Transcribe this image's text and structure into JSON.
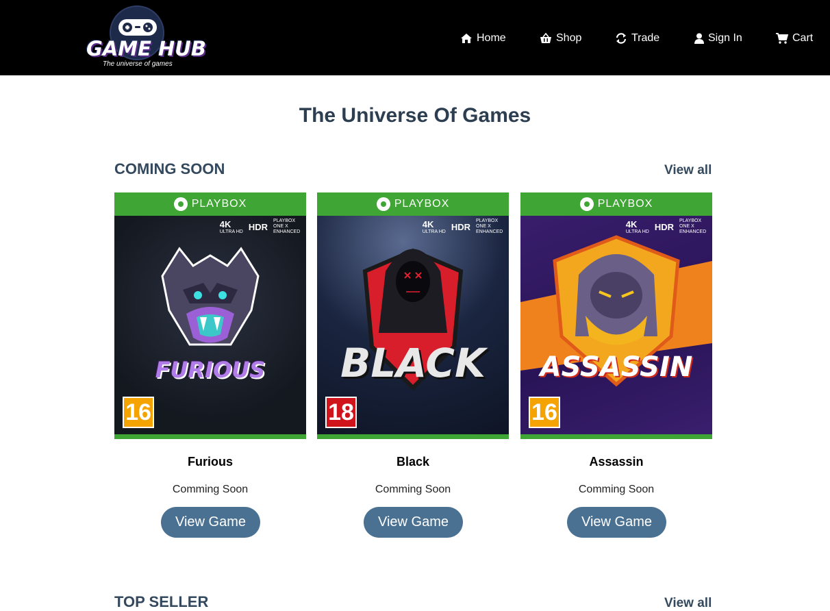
{
  "brand": {
    "name": "GAME HUB",
    "tagline": "The universe of games"
  },
  "nav": [
    {
      "label": "Home",
      "icon": "home-icon"
    },
    {
      "label": "Shop",
      "icon": "basket-icon"
    },
    {
      "label": "Trade",
      "icon": "refresh-icon"
    },
    {
      "label": "Sign In",
      "icon": "user-icon"
    },
    {
      "label": "Cart",
      "icon": "cart-icon"
    }
  ],
  "page_title": "The Universe Of Games",
  "sections": [
    {
      "title": "COMING SOON",
      "view_all": "View all",
      "games": [
        {
          "cover_brand": "PLAYBOX",
          "cover_art_text": "FURIOUS",
          "age_rating": "16",
          "age_color": "#f4a300",
          "name": "Furious",
          "status": "Comming Soon",
          "button": "View Game"
        },
        {
          "cover_brand": "PLAYBOX",
          "cover_art_text": "BLACK",
          "age_rating": "18",
          "age_color": "#d0141c",
          "name": "Black",
          "status": "Comming Soon",
          "button": "View Game"
        },
        {
          "cover_brand": "PLAYBOX",
          "cover_art_text": "ASSASSIN",
          "age_rating": "16",
          "age_color": "#f4a300",
          "name": "Assassin",
          "status": "Comming Soon",
          "button": "View Game"
        }
      ]
    },
    {
      "title": "TOP SELLER",
      "view_all": "View all"
    }
  ],
  "cover_badges": {
    "resolution": "4K",
    "resolution_sub": "ULTRA HD",
    "hdr": "HDR",
    "enhanced": "PLAYBOX ONE X ENHANCED"
  },
  "colors": {
    "header_bg": "#000000",
    "heading": "#2c3e50",
    "button_bg": "#4a7191",
    "cover_green": "#3fa535"
  }
}
